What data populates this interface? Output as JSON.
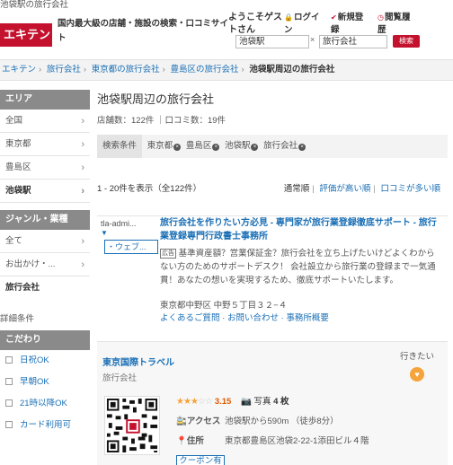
{
  "top_caption": "池袋駅の旅行会社",
  "header": {
    "logo": "エキテン",
    "tagline": "国内最大級の店舗・施設の検索・口コミサイト",
    "welcome": "ようこそゲストさん",
    "links": [
      {
        "icon": "lock-icon",
        "line1": "ログイ",
        "line2": "ン"
      },
      {
        "icon": "check-icon",
        "line1": "新規登",
        "line2": "録"
      },
      {
        "icon": "clock-icon",
        "line1": "閲覧履",
        "line2": "歴"
      }
    ],
    "search": {
      "area_value": "池袋駅",
      "category_value": "旅行会社",
      "button": "検索"
    }
  },
  "breadcrumb": [
    "エキテン",
    "旅行会社",
    "東京都の旅行会社",
    "豊島区の旅行会社",
    "池袋駅周辺の旅行会社"
  ],
  "sidebar": {
    "area_heading": "エリア",
    "area_items": [
      {
        "label": "全国",
        "active": false
      },
      {
        "label": "東京都",
        "active": false
      },
      {
        "label": "豊島区",
        "active": false
      },
      {
        "label": "池袋駅",
        "active": true
      }
    ],
    "genre_heading": "ジャンル・業種",
    "genre_items": [
      {
        "label": "全て",
        "active": false
      },
      {
        "label": "お出かけ・...",
        "active": false
      },
      {
        "label": "旅行会社",
        "active": true
      }
    ],
    "detail_link": "詳細条件",
    "kodawari_heading": "こだわり",
    "kodawari_items": [
      "日祝OK",
      "早朝OK",
      "21時以降OK",
      "カード利用可"
    ]
  },
  "main": {
    "title": "池袋駅周辺の旅行会社",
    "counts": "店舗数：122件 ｜口コミ数：19件",
    "filter_label": "検索条件",
    "filter_tags": [
      "東京都",
      "豊島区",
      "池袋駅",
      "旅行会社"
    ],
    "range": "1 - 20件を表示（全122件）",
    "sorts": [
      {
        "label": "通常順",
        "current": true
      },
      {
        "label": "評価が高い順",
        "current": false
      },
      {
        "label": "口コミが多い順",
        "current": false
      }
    ]
  },
  "ad": {
    "user": "tla-admi...",
    "arrow": "▼",
    "web_button": "・ウェブ...",
    "title": "旅行会社を作りたい方必見 - 専門家が旅行業登録徹底サポート - 旅行業登録専門行政書士事務所",
    "badge": "広告",
    "text": "基準資産額？営業保証金？旅行会社を立ち上げたいけどよくわからない方のためのサポートデスク！ 会社設立から旅行業の登録まで一気通貫！あなたの想いを実現するため、徹底サポートいたします。",
    "address": "東京都中野区 中野５丁目３２−４",
    "links": "よくあるご質問 · お問い合わせ · 事務所概要"
  },
  "card": {
    "name": "東京国際トラベル",
    "category": "旅行会社",
    "want_go": "行きたい",
    "rating_stars": 3,
    "rating_max": 5,
    "score": "3.15",
    "photo_label": "写真",
    "photo_count": "4 枚",
    "access_label": "アクセス",
    "access_value": "池袋駅から590m （徒歩8分）",
    "address_label": "住所",
    "address_value": "東京都豊島区池袋2-22-1添田ビル４階",
    "coupon": "クーポン有"
  }
}
